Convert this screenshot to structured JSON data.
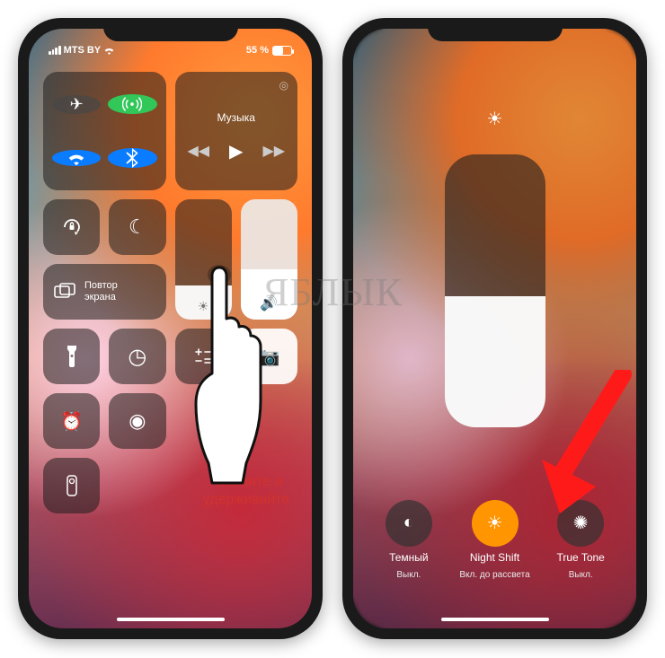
{
  "watermark": "ЯБЛЫК",
  "annotation": {
    "line1": "Нажмите и",
    "line2": "удерживайте"
  },
  "status": {
    "carrier": "MTS BY",
    "battery_pct": "55 %",
    "battery_fill": 55
  },
  "cc": {
    "music_label": "Музыка",
    "mirror_label": "Повтор\nэкрана",
    "icons": {
      "airplane": "✈",
      "cellular": "⦿",
      "wifi": "wifi",
      "bluetooth": "bt",
      "airplay": "◎",
      "prev": "◀◀",
      "play": "▶",
      "next": "▶▶",
      "orientation_lock": "lock-rotate",
      "dnd": "☾",
      "screen_mirror": "⧉",
      "brightness": "☀",
      "volume": "🔊",
      "flashlight": "flashlight",
      "timer": "◷",
      "calculator": "calc",
      "camera": "📷",
      "alarm": "⏰",
      "screen_record": "◉",
      "remote": "▯"
    }
  },
  "brightness_detail": {
    "fill_pct": 48,
    "options": [
      {
        "id": "dark-mode",
        "label": "Темный",
        "sub": "Выкл.",
        "active": false,
        "icon": "◐"
      },
      {
        "id": "night-shift",
        "label": "Night Shift",
        "sub": "Вкл. до рассвета",
        "active": true,
        "icon": "☀"
      },
      {
        "id": "true-tone",
        "label": "True Tone",
        "sub": "Выкл.",
        "active": false,
        "icon": "✺"
      }
    ]
  }
}
